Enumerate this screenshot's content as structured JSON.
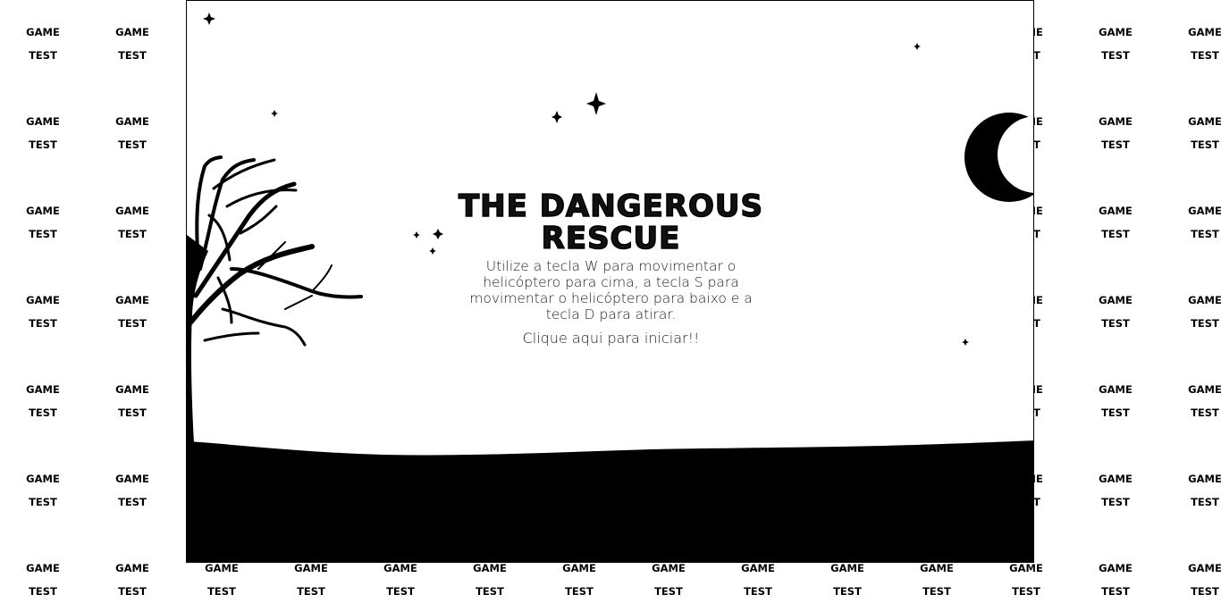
{
  "background": {
    "tile_line1": "GAME",
    "tile_line2": "TEST"
  },
  "game": {
    "title": "THE DANGEROUS RESCUE",
    "instructions": "Utilize a tecla W para movimentar o helicóptero para cima, a tecla S para movimentar o helicóptero para baixo e a tecla D para atirar.",
    "start_label": "Clique aqui para iniciar!!",
    "colors": {
      "ink": "#000000",
      "paper": "#ffffff"
    }
  }
}
